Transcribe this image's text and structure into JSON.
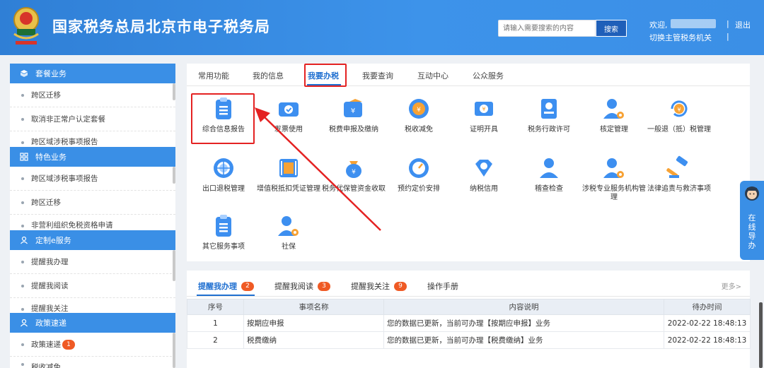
{
  "header": {
    "title": "国家税务总局北京市电子税务局",
    "search_placeholder": "请输入需要搜索的内容",
    "search_label": "搜索",
    "welcome": "欢迎,",
    "separator": "|",
    "logout": "退出",
    "switch_org": "切换主管税务机关"
  },
  "sidebar": {
    "sections": [
      {
        "title": "套餐业务",
        "items": [
          "跨区迁移",
          "取消非正常户认定套餐",
          "跨区域涉税事项报告"
        ]
      },
      {
        "title": "特色业务",
        "items": [
          "跨区域涉税事项报告",
          "跨区迁移",
          "非营利组织免税资格申请"
        ]
      },
      {
        "title": "定制e服务",
        "items": [
          "提醒我办理",
          "提醒我阅读",
          "提醒我关注"
        ]
      },
      {
        "title": "政策速递",
        "items": [
          "政策速递",
          "税收减免"
        ],
        "badge": "1"
      }
    ]
  },
  "tabs": [
    "常用功能",
    "我的信息",
    "我要办税",
    "我要查询",
    "互动中心",
    "公众服务"
  ],
  "functions": [
    {
      "label": "综合信息报告",
      "icon": "clipboard-icon"
    },
    {
      "label": "发票使用",
      "icon": "ticket-icon"
    },
    {
      "label": "税费申报及缴纳",
      "icon": "wallet-icon"
    },
    {
      "label": "税收减免",
      "icon": "coin-icon"
    },
    {
      "label": "证明开具",
      "icon": "certificate-icon"
    },
    {
      "label": "税务行政许可",
      "icon": "id-card-icon"
    },
    {
      "label": "核定管理",
      "icon": "user-gear-icon"
    },
    {
      "label": "一般退（抵）税管理",
      "icon": "refund-icon"
    },
    {
      "label": "出口退税管理",
      "icon": "globe-icon"
    },
    {
      "label": "增值税抵扣凭证管理",
      "icon": "film-icon"
    },
    {
      "label": "税务代保管资金收取",
      "icon": "money-bag-icon"
    },
    {
      "label": "预约定价安排",
      "icon": "gauge-icon"
    },
    {
      "label": "纳税信用",
      "icon": "diamond-icon"
    },
    {
      "label": "稽查检查",
      "icon": "person-icon"
    },
    {
      "label": "涉税专业服务机构管理",
      "icon": "user-tie-icon"
    },
    {
      "label": "法律追责与救济事项",
      "icon": "gavel-icon"
    },
    {
      "label": "其它服务事项",
      "icon": "list-icon"
    },
    {
      "label": "社保",
      "icon": "user-settings-icon"
    }
  ],
  "notify": {
    "tabs": [
      {
        "label": "提醒我办理",
        "count": "2"
      },
      {
        "label": "提醒我阅读",
        "count": "3"
      },
      {
        "label": "提醒我关注",
        "count": "9"
      },
      {
        "label": "操作手册",
        "count": ""
      }
    ],
    "more": "更多>",
    "columns": [
      "序号",
      "事项名称",
      "内容说明",
      "待办时间"
    ],
    "rows": [
      [
        "1",
        "按期应申报",
        "您的数据已更新，当前可办理【按期应申报】业务",
        "2022-02-22 18:48:13"
      ],
      [
        "2",
        "税费缴纳",
        "您的数据已更新，当前可办理【税费缴纳】业务",
        "2022-02-22 18:48:13"
      ]
    ]
  },
  "guide": {
    "text": "在线导办"
  },
  "colors": {
    "header": "#3a8fe6",
    "accent": "#1f6fd0",
    "highlight": "#e42222",
    "badge": "#ef5a24"
  }
}
